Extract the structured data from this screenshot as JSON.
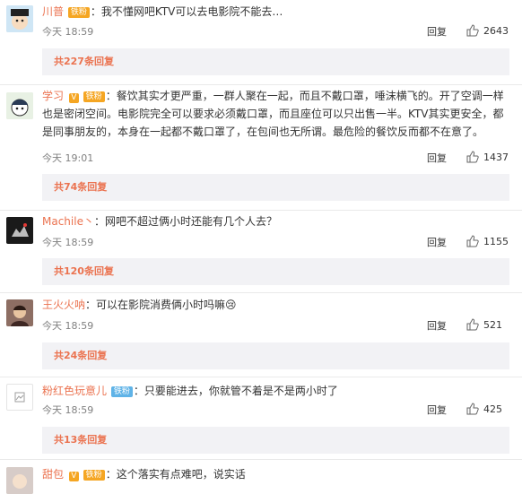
{
  "comments": [
    {
      "user": "川普",
      "badges": [
        "铁粉"
      ],
      "colon": "：",
      "text": "我不懂网吧KTV可以去电影院不能去…",
      "time": "今天 18:59",
      "reply_label": "回复",
      "likes": "2643",
      "replies": "共227条回复"
    },
    {
      "user": "学习",
      "badges": [
        "铁粉"
      ],
      "vip": "V",
      "colon": "：",
      "text": "餐饮其实才更严重，一群人聚在一起，而且不戴口罩，唾沫横飞的。开了空调一样也是密闭空间。电影院完全可以要求必须戴口罩，而且座位可以只出售一半。KTV其实更安全，都是同事朋友的，本身在一起都不戴口罩了，在包间也无所谓。最危险的餐饮反而都不在意了。",
      "time": "今天 19:01",
      "reply_label": "回复",
      "likes": "1437",
      "replies": "共74条回复"
    },
    {
      "user": "Machile丶",
      "colon": "：",
      "text": "网吧不超过俩小时还能有几个人去？",
      "time": "今天 18:59",
      "reply_label": "回复",
      "likes": "1155",
      "replies": "共120条回复"
    },
    {
      "user": "王火火呐",
      "colon": "：",
      "text": "可以在影院消费俩小时吗嘛😢",
      "time": "今天 18:59",
      "reply_label": "回复",
      "likes": "521",
      "replies": "共24条回复"
    },
    {
      "user": "粉红色玩意儿",
      "badges": [
        "铁粉"
      ],
      "colon": "：",
      "text": "只要能进去，你就管不着是不是两小时了",
      "time": "今天 18:59",
      "reply_label": "回复",
      "likes": "425",
      "replies": "共13条回复"
    },
    {
      "user": "甜包",
      "badges": [
        "铁粉"
      ],
      "vip": "V",
      "colon": "：",
      "text": "这个落实有点难吧，说实话"
    }
  ],
  "colors": {
    "username": "#eb7350",
    "badge_gold": "#f5a623",
    "badge_blue": "#5fb3e7",
    "meta": "#808080"
  },
  "icons": {
    "like": "thumbs-up-icon"
  }
}
